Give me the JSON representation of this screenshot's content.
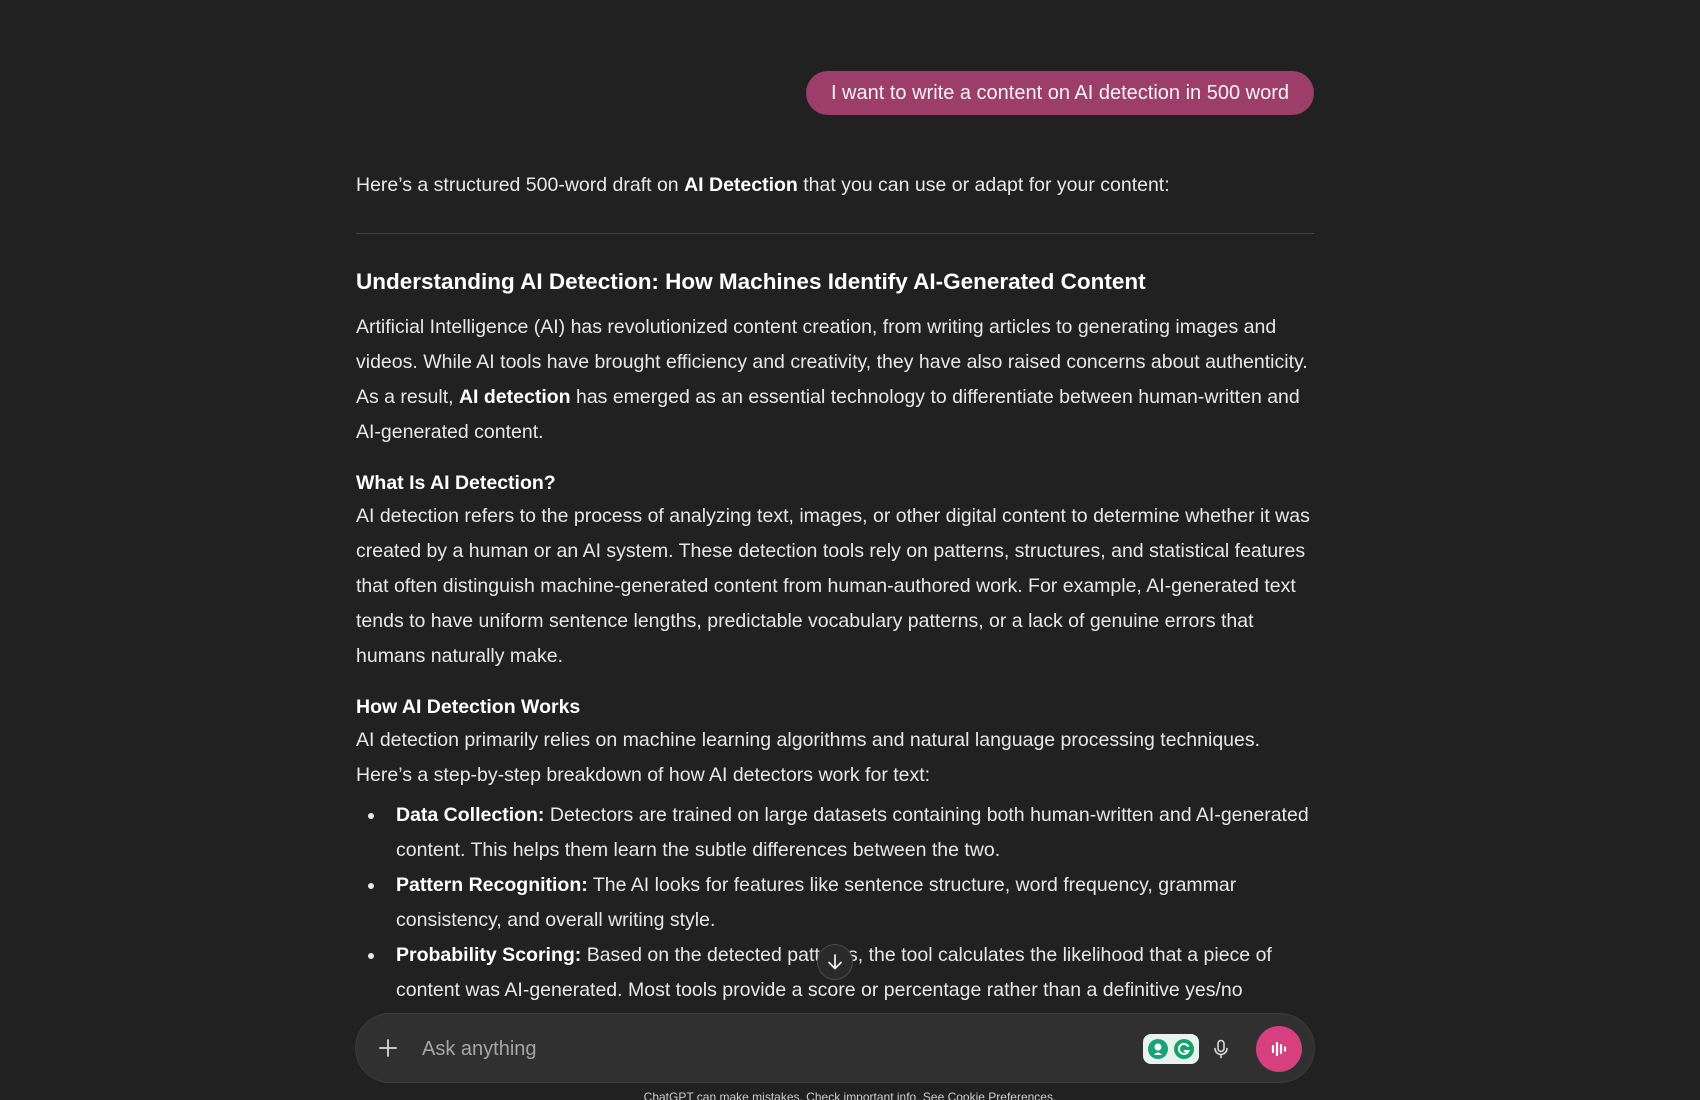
{
  "chat": {
    "user_message": "I want to write a content on AI detection in 500 word",
    "intro": {
      "before": "Here’s a structured 500-word draft on ",
      "bold": "AI Detection",
      "after": " that you can use or adapt for your content:"
    },
    "article_title": "Understanding AI Detection: How Machines Identify AI-Generated Content",
    "para1": {
      "before": "Artificial Intelligence (AI) has revolutionized content creation, from writing articles to generating images and videos. While AI tools have brought efficiency and creativity, they have also raised concerns about authenticity. As a result, ",
      "bold": "AI detection",
      "after": " has emerged as an essential technology to differentiate between human-written and AI-generated content."
    },
    "section1": {
      "heading": "What Is AI Detection?",
      "body": "AI detection refers to the process of analyzing text, images, or other digital content to determine whether it was created by a human or an AI system. These detection tools rely on patterns, structures, and statistical features that often distinguish machine-generated content from human-authored work. For example, AI-generated text tends to have uniform sentence lengths, predictable vocabulary patterns, or a lack of genuine errors that humans naturally make."
    },
    "section2": {
      "heading": "How AI Detection Works",
      "body": "AI detection primarily relies on machine learning algorithms and natural language processing techniques. Here’s a step-by-step breakdown of how AI detectors work for text:",
      "bullets": [
        {
          "label": "Data Collection:",
          "text": " Detectors are trained on large datasets containing both human-written and AI-generated content. This helps them learn the subtle differences between the two."
        },
        {
          "label": "Pattern Recognition:",
          "text": " The AI looks for features like sentence structure, word frequency, grammar consistency, and overall writing style."
        },
        {
          "label": "Probability Scoring:",
          "text": " Based on the detected patterns, the tool calculates the likelihood that a piece of content was AI-generated. Most tools provide a score or percentage rather than a definitive yes/no"
        }
      ]
    }
  },
  "composer": {
    "placeholder": "Ask anything"
  },
  "footer": {
    "disclaimer": "ChatGPT can make mistakes. Check important info. See Cookie Preferences."
  },
  "icons": {
    "plus": "plus-icon",
    "scroll": "arrow-down-icon",
    "mic": "microphone-icon",
    "voice": "voice-waveform-icon",
    "extensions": [
      "extension-icon",
      "grammarly-icon"
    ]
  },
  "colors": {
    "background": "#212121",
    "user_bubble": "#9c3d6a",
    "composer": "#303030",
    "voice_button": "#d6407e"
  }
}
